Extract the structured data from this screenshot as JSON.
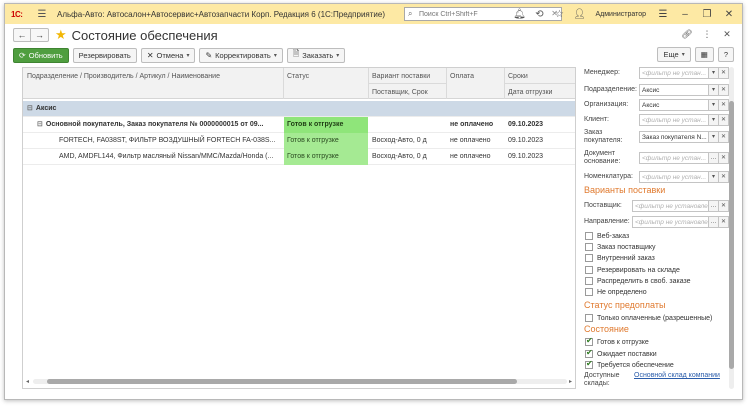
{
  "app": {
    "logo": "1С:",
    "title": "Альфа-Авто: Автосалон+Автосервис+Автозапчасти Корп. Редакция 6  (1С:Предприятие)",
    "search_placeholder": "Поиск Ctrl+Shift+F",
    "user": "Администратор"
  },
  "form": {
    "title": "Состояние обеспечения"
  },
  "toolbar": {
    "refresh": "Обновить",
    "reserve": "Резервировать",
    "cancel": "Отмена",
    "correct": "Корректировать",
    "order": "Заказать",
    "more": "Еще"
  },
  "table": {
    "headers": {
      "col1": "Подразделение / Производитель / Артикул / Наименование",
      "status": "Статус",
      "delivery": "Вариант поставки",
      "delivery_sub": "Поставщик, Срок",
      "payment": "Оплата",
      "terms": "Сроки",
      "terms_sub": "Дата отгрузки"
    },
    "group": "Аксис",
    "order": {
      "name": "Основной покупатель, Заказ покупателя № 0000000015 от 09...",
      "status": "Готов к отгрузке",
      "payment": "не оплачено",
      "date": "09.10.2023"
    },
    "rows": [
      {
        "name": "FORTECH, FA038ST, ФИЛЬТР ВОЗДУШНЫЙ FORTECH FA-038S...",
        "status": "Готов к отгрузке",
        "supplier": "Восход-Авто, 0 д",
        "payment": "не оплачено",
        "date": "09.10.2023"
      },
      {
        "name": "AMD, AMDFL144, Фильтр масляный Nissan/MMC/Mazda/Honda (...",
        "status": "Готов к отгрузке",
        "supplier": "Восход-Авто, 0 д",
        "payment": "не оплачено",
        "date": "09.10.2023"
      }
    ]
  },
  "filters": {
    "placeholder": "<фильтр не установлен>",
    "placeholder_short": "<фильтр не устан...",
    "manager_label": "Менеджер:",
    "division_label": "Подразделение:",
    "division_value": "Аксис",
    "org_label": "Организация:",
    "org_value": "Аксис",
    "client_label": "Клиент:",
    "order_label": "Заказ покупателя:",
    "order_value": "Заказ покупателя N...",
    "doc_label": "Документ основание:",
    "nomen_label": "Номенклатура:",
    "variants_title": "Варианты поставки",
    "supplier_label": "Поставщик:",
    "direction_label": "Направление:",
    "variants": [
      {
        "label": "Веб-заказ",
        "checked": false
      },
      {
        "label": "Заказ поставщику",
        "checked": false
      },
      {
        "label": "Внутренний заказ",
        "checked": false
      },
      {
        "label": "Резервировать на складе",
        "checked": false
      },
      {
        "label": "Распределить в своб. заказе",
        "checked": false
      },
      {
        "label": "Не определено",
        "checked": false
      }
    ],
    "prepay_title": "Статус предоплаты",
    "prepay_only": "Только оплаченные (разрешенные)",
    "state_title": "Состояние",
    "states": [
      {
        "label": "Готов к отгрузке",
        "checked": true
      },
      {
        "label": "Ожидает поставки",
        "checked": true
      },
      {
        "label": "Требуется обеспечение",
        "checked": true
      }
    ],
    "warehouses_label": "Доступные склады:",
    "warehouses_link": "Основной склад компании"
  }
}
